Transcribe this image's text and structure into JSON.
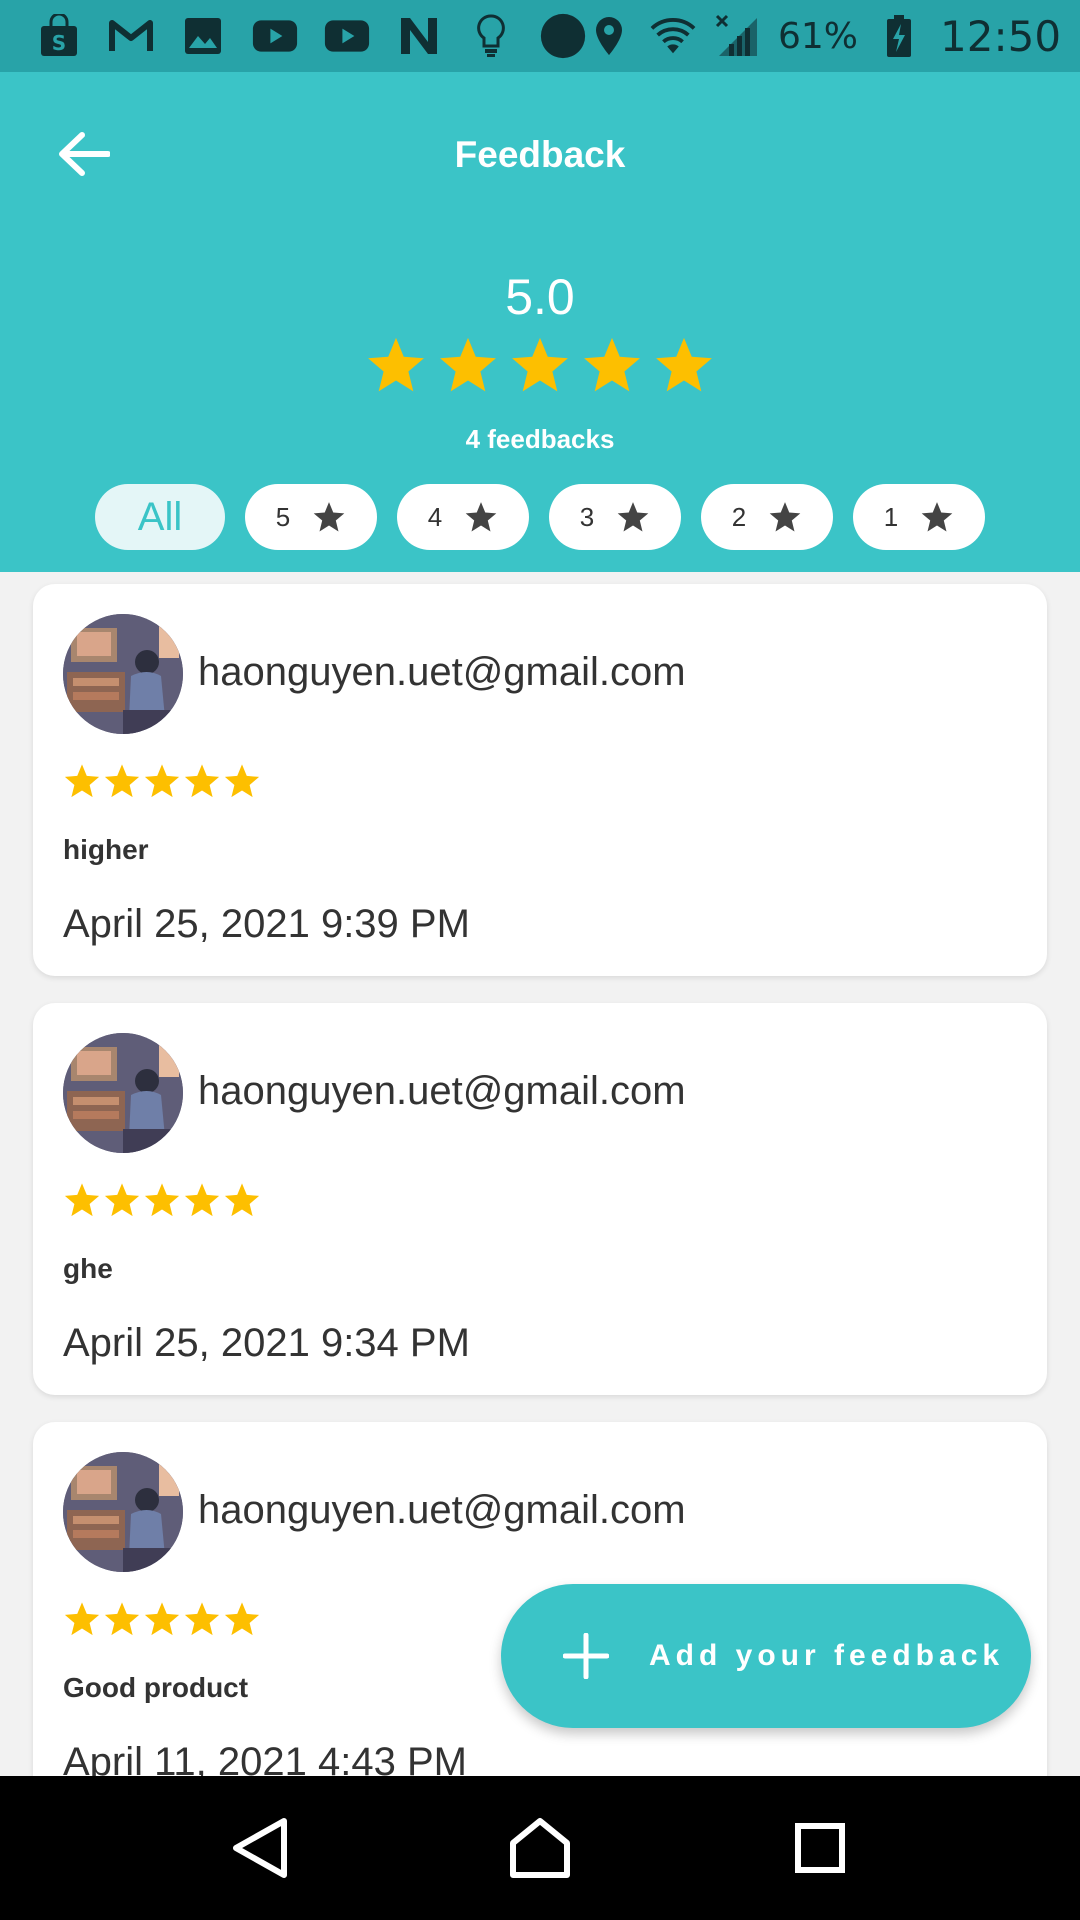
{
  "status_bar": {
    "icons_left": [
      "shopping-bag-icon",
      "gmail-icon",
      "image-icon",
      "youtube-icon",
      "youtube-icon",
      "n-app-icon",
      "lightbulb-icon",
      "circle-app-icon"
    ],
    "icons_right": [
      "location-icon",
      "wifi-icon",
      "signal-icon",
      "battery-charging-icon"
    ],
    "battery": "61%",
    "time": "12:50"
  },
  "header": {
    "title": "Feedback",
    "score": "5.0",
    "rating_stars": 5,
    "feedback_count": "4 feedbacks"
  },
  "filters": {
    "all_label": "All",
    "star_options": [
      "5",
      "4",
      "3",
      "2",
      "1"
    ]
  },
  "feedbacks": [
    {
      "email": "haonguyen.uet@gmail.com",
      "stars": 5,
      "comment": "higher",
      "date": "April 25, 2021 9:39 PM"
    },
    {
      "email": "haonguyen.uet@gmail.com",
      "stars": 5,
      "comment": "ghe",
      "date": "April 25, 2021 9:34 PM"
    },
    {
      "email": "haonguyen.uet@gmail.com",
      "stars": 5,
      "comment": "Good product",
      "date": "April 11, 2021 4:43 PM"
    }
  ],
  "fab": {
    "label": "Add your feedback"
  },
  "colors": {
    "accent": "#3bc4c7",
    "status_bar": "#28a3a8",
    "star": "#fdbf00"
  }
}
